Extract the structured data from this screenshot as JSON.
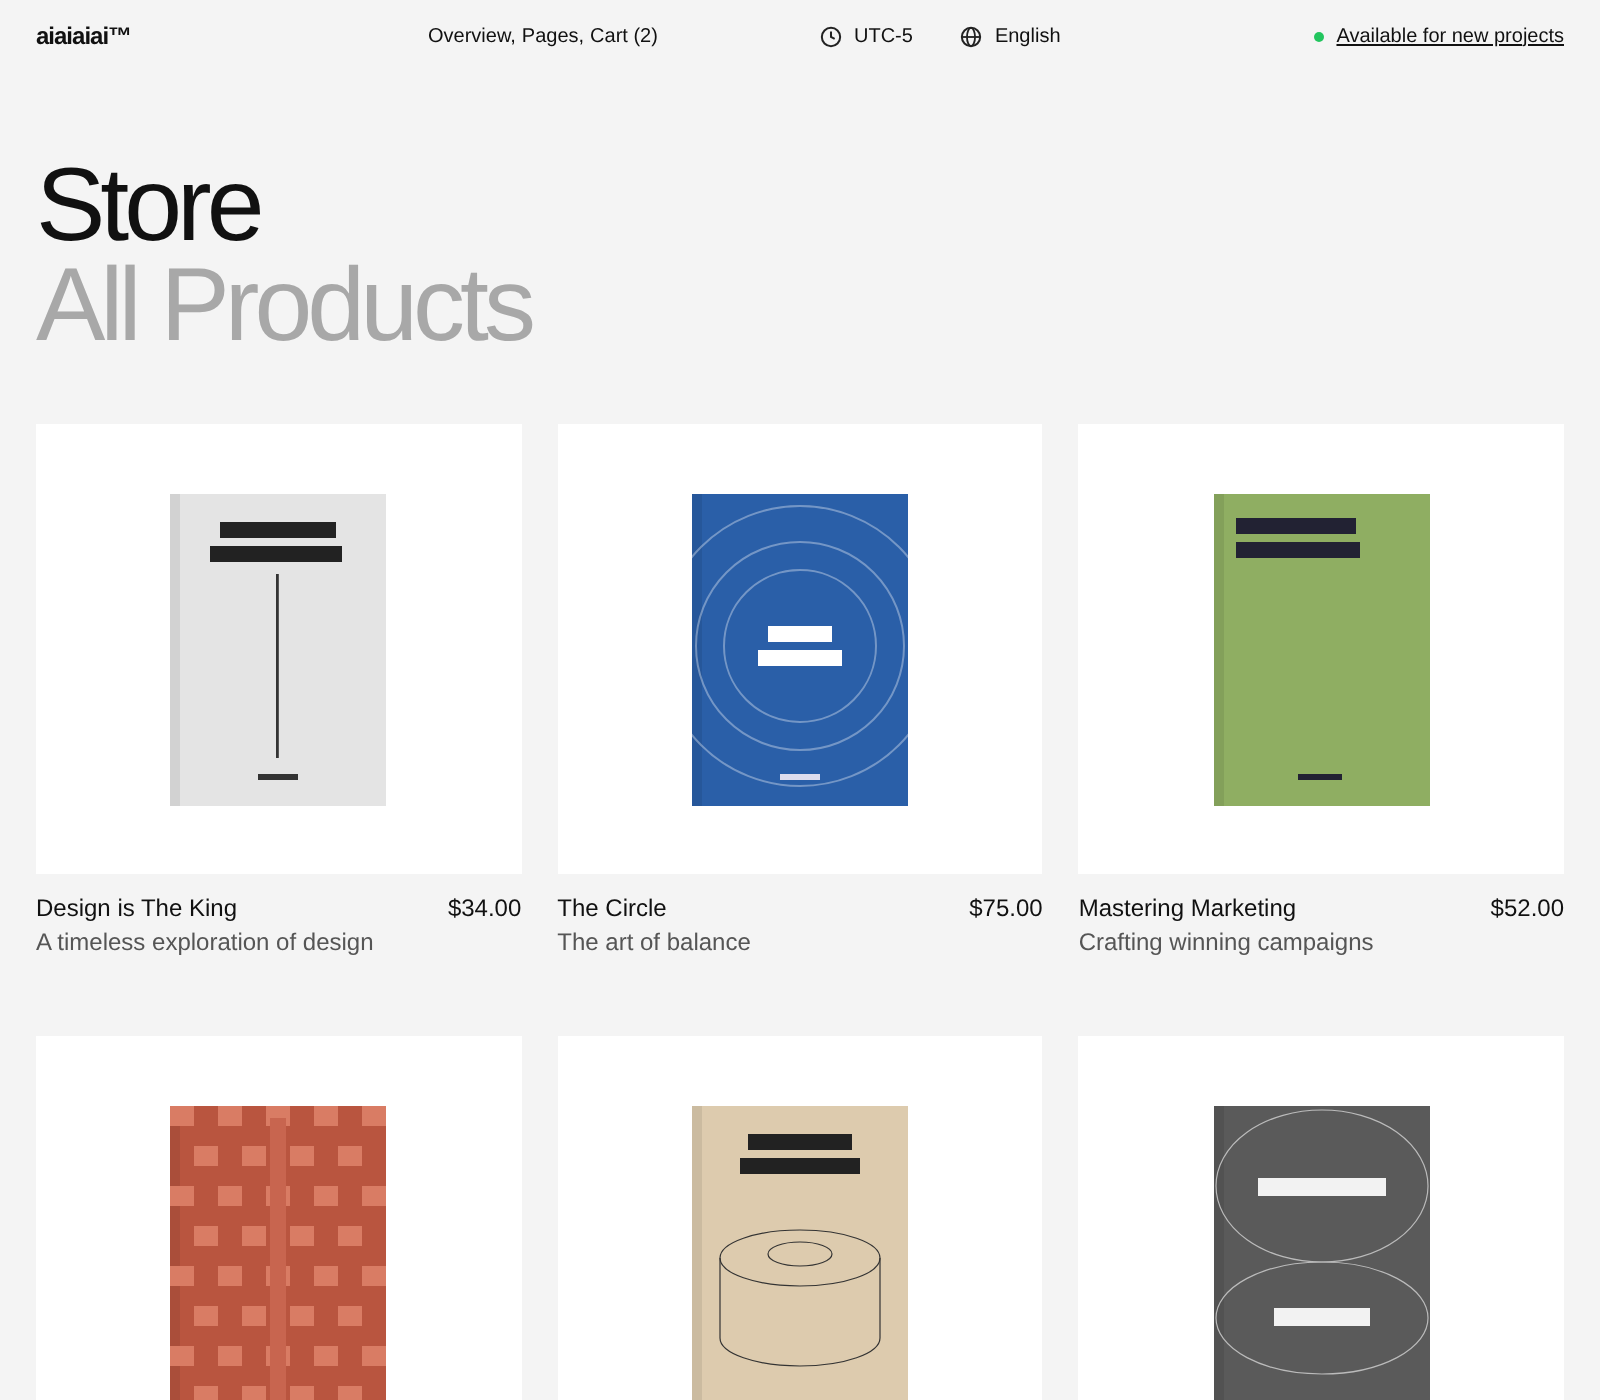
{
  "header": {
    "logo": "aiaiaiai™",
    "nav": [
      "Overview,",
      "Pages,",
      "Cart (2)"
    ],
    "timezone": "UTC-5",
    "language": "English",
    "availability": {
      "label": "Available for new projects",
      "color": "#22c55e"
    }
  },
  "heading": {
    "title": "Store",
    "subtitle": "All Products"
  },
  "products": [
    {
      "image": {
        "kind": "picture"
      },
      "title": "Design is The King",
      "price": "$34.00",
      "description": "A timeless exploration of design"
    },
    {
      "image": {
        "kind": "picture"
      },
      "title": "The Circle",
      "price": "$75.00",
      "description": "The art of balance"
    },
    {
      "image": {
        "kind": "picture"
      },
      "title": "Mastering Marketing",
      "price": "$52.00",
      "description": "Crafting winning campaigns"
    },
    {
      "image": {
        "kind": "picture"
      }
    },
    {
      "image": {
        "kind": "picture"
      }
    },
    {
      "image": {
        "kind": "picture"
      }
    }
  ]
}
